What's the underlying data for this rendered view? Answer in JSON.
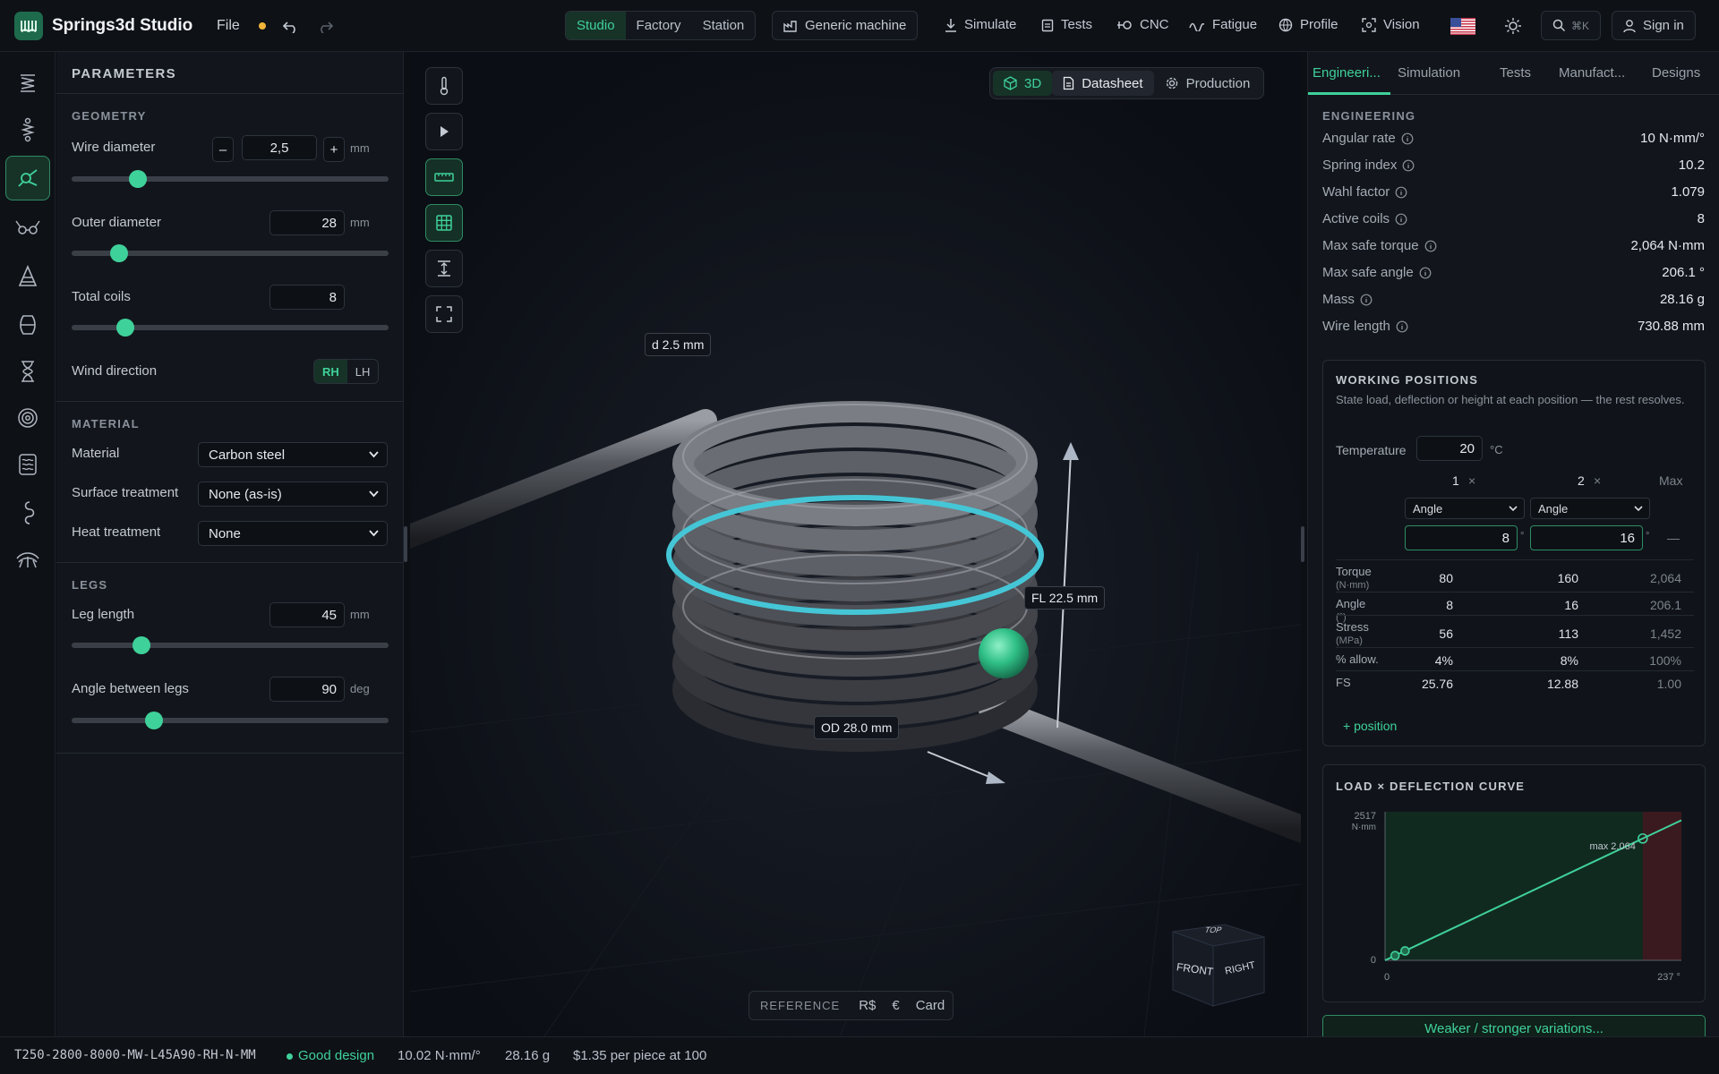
{
  "app": {
    "title": "Springs3d Studio",
    "file_menu": "File"
  },
  "topnav": {
    "modes": [
      "Studio",
      "Factory",
      "Station"
    ],
    "machine": "Generic machine",
    "actions": [
      "Simulate",
      "Tests",
      "CNC",
      "Fatigue",
      "Profile",
      "Vision"
    ],
    "search_shortcut": "⌘K",
    "signin": "Sign in"
  },
  "params": {
    "header": "PARAMETERS",
    "geometry": {
      "title": "GEOMETRY",
      "wire_diameter": {
        "label": "Wire diameter",
        "value": "2,5",
        "unit": "mm",
        "minus": "–",
        "plus": "+",
        "level": 0.21
      },
      "outer_diameter": {
        "label": "Outer diameter",
        "value": "28",
        "unit": "mm",
        "level": 0.15
      },
      "total_coils": {
        "label": "Total coils",
        "value": "8",
        "level": 0.17
      },
      "wind_direction": {
        "label": "Wind direction",
        "options": [
          "RH",
          "LH"
        ],
        "selected": "RH"
      }
    },
    "material": {
      "title": "MATERIAL",
      "material": {
        "label": "Material",
        "value": "Carbon steel"
      },
      "surface": {
        "label": "Surface treatment",
        "value": "None (as-is)"
      },
      "heat": {
        "label": "Heat treatment",
        "value": "None"
      }
    },
    "legs": {
      "title": "LEGS",
      "leg_length": {
        "label": "Leg length",
        "value": "45",
        "unit": "mm",
        "level": 0.22
      },
      "angle": {
        "label": "Angle between legs",
        "value": "90",
        "unit": "deg",
        "level": 0.26
      }
    }
  },
  "viewport": {
    "views": [
      "3D",
      "Datasheet",
      "Production"
    ],
    "active_view": "3D",
    "labels": {
      "wire": "d 2.5 mm",
      "free_length": "FL 22.5 mm",
      "outer": "OD 28.0 mm"
    },
    "cube": {
      "top": "TOP",
      "front": "FRONT",
      "right": "RIGHT"
    },
    "reference": {
      "label": "REFERENCE",
      "options": [
        "R$",
        "€",
        "Card"
      ]
    }
  },
  "right": {
    "tabs": [
      "Engineeri...",
      "Simulation",
      "Tests",
      "Manufact...",
      "Designs"
    ],
    "engineering": {
      "title": "ENGINEERING",
      "rows": [
        {
          "label": "Angular rate",
          "value": "10 N·mm/°"
        },
        {
          "label": "Spring index",
          "value": "10.2"
        },
        {
          "label": "Wahl factor",
          "value": "1.079"
        },
        {
          "label": "Active coils",
          "value": "8"
        },
        {
          "label": "Max safe torque",
          "value": "2,064 N·mm"
        },
        {
          "label": "Max safe angle",
          "value": "206.1 °"
        },
        {
          "label": "Mass",
          "value": "28.16 g"
        },
        {
          "label": "Wire length",
          "value": "730.88 mm"
        }
      ]
    },
    "working": {
      "title": "WORKING POSITIONS",
      "desc": "State load, deflection or height at each position — the rest resolves.",
      "temperature": {
        "label": "Temperature",
        "value": "20",
        "unit": "°C"
      },
      "col1": "1",
      "col2": "2",
      "close": "×",
      "max": "Max",
      "mode1": "Angle",
      "mode2": "Angle",
      "in1": "8",
      "in2": "16",
      "deg": "°",
      "dash": "—",
      "rows": [
        {
          "label": "Torque",
          "sub": "(N·mm)",
          "a": "80",
          "b": "160",
          "max": "2,064"
        },
        {
          "label": "Angle",
          "sub": "(°)",
          "a": "8",
          "b": "16",
          "max": "206.1"
        },
        {
          "label": "Stress",
          "sub": "(MPa)",
          "a": "56",
          "b": "113",
          "max": "1,452"
        },
        {
          "label": "% allow.",
          "sub": "",
          "a": "4%",
          "b": "8%",
          "max": "100%"
        },
        {
          "label": "FS",
          "sub": "",
          "a": "25.76",
          "b": "12.88",
          "max": "1.00"
        }
      ],
      "add": "+ position"
    },
    "curve": {
      "title": "LOAD × DEFLECTION CURVE"
    },
    "variations": "Weaker / stronger variations..."
  },
  "chart_data": {
    "type": "line",
    "title": "LOAD × DEFLECTION CURVE",
    "xlabel": "°",
    "ylabel": "N·mm",
    "x": [
      0,
      8,
      16,
      206.1,
      237
    ],
    "y": [
      0,
      80,
      160,
      2064,
      2373
    ],
    "xlim": [
      0,
      237
    ],
    "ylim": [
      0,
      2517
    ],
    "xticks": [
      "0",
      "237 °"
    ],
    "yticks": [
      "0",
      "2517"
    ],
    "y_unit_label": "N·mm",
    "annotation": "max 2,064",
    "points": [
      {
        "x": 8,
        "y": 80
      },
      {
        "x": 16,
        "y": 160
      },
      {
        "x": 206.1,
        "y": 2064
      }
    ],
    "safe_zone_end": 206.1
  },
  "status": {
    "code": "T250-2800-8000-MW-L45A90-RH-N-MM",
    "verdict": "Good design",
    "rate": "10.02 N·mm/°",
    "mass": "28.16 g",
    "price": "$1.35 per piece at 100"
  },
  "colors": {
    "accent": "#3fd19a",
    "accent_bg": "#173328",
    "danger_zone": "#4a1c22",
    "highlight_ring": "#45c6d6"
  }
}
